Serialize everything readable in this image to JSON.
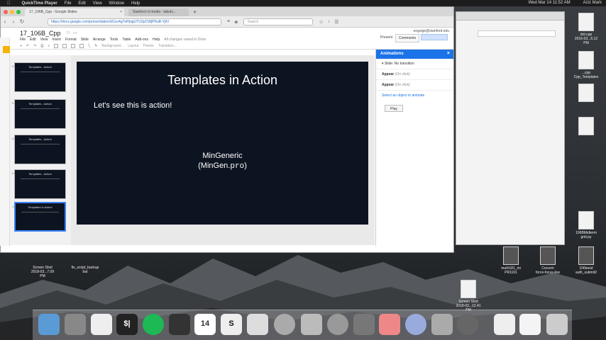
{
  "menubar": {
    "app": "QuickTime Player",
    "items": [
      "File",
      "Edit",
      "View",
      "Window",
      "Help"
    ],
    "clock": "Wed Mar 14 11:52 AM",
    "user": "Aziz Mark"
  },
  "browser": {
    "tab_active": "17_106B_Cpp - Google Slides",
    "tab_inactive": "Stanford sl media - tabulo...",
    "url": "https://docs.google.com/presentation/d/1sv4g7eRbqjUYU2pCWjPRuB-YjKI",
    "search_placeholder": "Search"
  },
  "docs": {
    "title": "17_106B_Cpp",
    "menu": [
      "File",
      "Edit",
      "View",
      "Insert",
      "Format",
      "Slide",
      "Arrange",
      "Tools",
      "Table",
      "Add-ons",
      "Help"
    ],
    "save_status": "All changes saved in Drive",
    "account": "engsige@stanford.edu",
    "present": "Present",
    "comments": "Comments",
    "toolbar_labels": [
      "Background...",
      "Layout",
      "Theme",
      "Transition..."
    ],
    "accent": "#1a73e8"
  },
  "slide": {
    "title": "Templates in Action",
    "body": "Let's see this is action!",
    "line1": "MinGeneric",
    "line2_pre": "(MinGen.",
    "line2_mono": "pro",
    "line2_post": ")",
    "background": "#0d1421"
  },
  "thumbs": [
    {
      "num": "10",
      "title": "Templates - Action"
    },
    {
      "num": "11",
      "title": "Templates - Action"
    },
    {
      "num": "12",
      "title": "Templates - Action"
    },
    {
      "num": "13",
      "title": "Templates - Action"
    },
    {
      "num": "14",
      "title": "Templates in Action"
    }
  ],
  "animations": {
    "header": "Animations",
    "transition": "Slide: No transition",
    "items": [
      {
        "label": "Appear",
        "note": "(On click)"
      },
      {
        "label": "Appear",
        "note": "(On click)"
      }
    ],
    "hint": "Select an object to animate",
    "play": "Play"
  },
  "desktop": {
    "icons": [
      {
        "label": "dot.cpp",
        "sub": "2016-03...6.12 PM"
      },
      {
        "label": "...cpp",
        "sub": "Cpp_Templates"
      },
      {
        "label": "",
        "sub": ""
      },
      {
        "label": "",
        "sub": ""
      },
      {
        "label": "106BMidterm",
        "sub": "grid.py"
      },
      {
        "label": "Screen Shot",
        "sub": "2018-03...7.09 PM"
      },
      {
        "label": "fix_script_backup",
        "sub": "bat"
      },
      {
        "label": "muth181_mi",
        "sub": "PR1101"
      },
      {
        "label": "Cocorm",
        "sub": "force-focus-low"
      },
      {
        "label": "106teest",
        "sub": "auth_submit2"
      },
      {
        "label": "Screen Shot",
        "sub": "2018-03...12.41 PM"
      }
    ]
  },
  "dock": {
    "items": [
      "finder",
      "launchpad",
      "preview",
      "terminal",
      "spotify",
      "slides",
      "calendar",
      "script",
      "messages",
      "textedit",
      "vpn",
      "chrome",
      "xcode",
      "vlc",
      "itunes",
      "photos",
      "quicktime",
      "files",
      "notes",
      "trash"
    ],
    "calendar_day": "14",
    "script_letter": "S",
    "terminal_text": "$|"
  }
}
